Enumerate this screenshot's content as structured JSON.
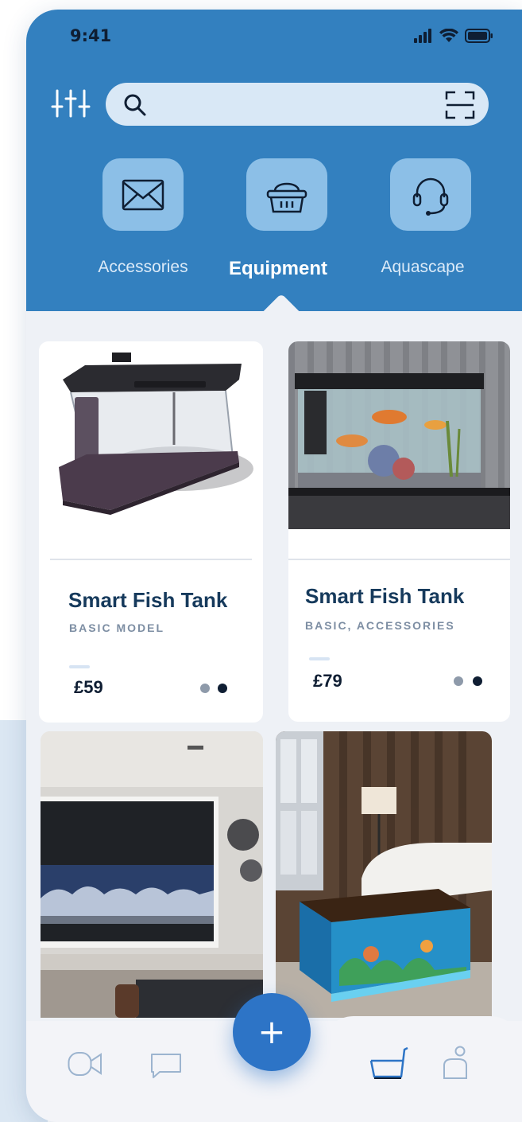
{
  "status": {
    "time": "9:41"
  },
  "search": {
    "placeholder": "",
    "value": ""
  },
  "categories": [
    {
      "label": "Accessories",
      "icon": "envelope-icon",
      "active": false
    },
    {
      "label": "Equipment",
      "icon": "basket-icon",
      "active": true
    },
    {
      "label": "Aquascape",
      "icon": "headset-icon",
      "active": false
    }
  ],
  "products": [
    {
      "title": "Smart Fish Tank",
      "subtitle": "BASIC MODEL",
      "price": "£59"
    },
    {
      "title": "Smart Fish Tank",
      "subtitle": "BASIC, ACCESSORIES",
      "price": "£79"
    }
  ],
  "nav": {
    "items": [
      "video-icon",
      "chat-icon",
      "cart-icon",
      "profile-icon"
    ],
    "fab_label": "+"
  },
  "colors": {
    "header": "#3380bf",
    "accent": "#2d74c6",
    "title": "#163a5c"
  }
}
